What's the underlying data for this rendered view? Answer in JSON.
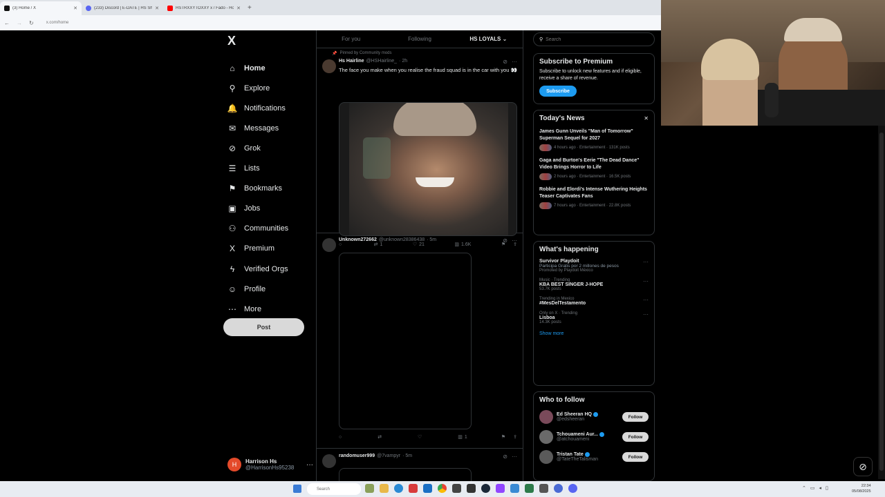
{
  "browser": {
    "tabs": [
      {
        "title": "(3) Home / X",
        "color": "#111111",
        "active": true
      },
      {
        "title": "(233) Discord | E-DATE | HS Sh...",
        "color": "#5865f2",
        "active": false
      },
      {
        "title": "HSTRXXYTOXXY x / Fado - Holic...",
        "color": "#ff0000",
        "active": false
      }
    ],
    "url": "x.com/home",
    "new_tab": "+"
  },
  "nav": {
    "logo": "X",
    "items": [
      {
        "label": "Home",
        "icon": "home-icon",
        "glyph": "⌂"
      },
      {
        "label": "Explore",
        "icon": "search-icon",
        "glyph": "⚲"
      },
      {
        "label": "Notifications",
        "icon": "bell-icon",
        "glyph": "🔔"
      },
      {
        "label": "Messages",
        "icon": "envelope-icon",
        "glyph": "✉"
      },
      {
        "label": "Grok",
        "icon": "grok-icon",
        "glyph": "⊘"
      },
      {
        "label": "Lists",
        "icon": "list-icon",
        "glyph": "☰"
      },
      {
        "label": "Bookmarks",
        "icon": "bookmark-icon",
        "glyph": "⚑"
      },
      {
        "label": "Jobs",
        "icon": "briefcase-icon",
        "glyph": "▣"
      },
      {
        "label": "Communities",
        "icon": "people-icon",
        "glyph": "⚇"
      },
      {
        "label": "Premium",
        "icon": "x-icon",
        "glyph": "X"
      },
      {
        "label": "Verified Orgs",
        "icon": "lightning-icon",
        "glyph": "ϟ"
      },
      {
        "label": "Profile",
        "icon": "person-icon",
        "glyph": "☺"
      },
      {
        "label": "More",
        "icon": "more-circle-icon",
        "glyph": "⋯"
      }
    ],
    "post_label": "Post",
    "account": {
      "initial": "H",
      "name": "Harrison Hs",
      "handle": "@HarrisonHs95238",
      "more": "···"
    }
  },
  "timeline": {
    "tabs": [
      "For you",
      "Following",
      "HS LOYALS ⌄"
    ],
    "tweets": [
      {
        "pinned": "Pinned by Community mods",
        "name": "Hs Hairline",
        "handle": "@HSHairline_",
        "time": "· 2h",
        "text": "The face you make when you realise the fraud squad is in the car with you 👀",
        "replies": "",
        "retweets": "1",
        "likes": "21",
        "views": "1.6K"
      },
      {
        "name": "Unknown272662",
        "handle": "@unknown28386438",
        "time": "· 5m",
        "replies": "",
        "retweets": "",
        "likes": "",
        "views": "1"
      },
      {
        "name": "randomuser999",
        "handle": "@7vampyr",
        "time": "· 5m"
      }
    ]
  },
  "right": {
    "search_placeholder": "Search",
    "premium": {
      "title": "Subscribe to Premium",
      "text": "Subscribe to unlock new features and if eligible, receive a share of revenue.",
      "button": "Subscribe"
    },
    "news": {
      "title": "Today's News",
      "close": "✕",
      "items": [
        {
          "title": "James Gunn Unveils \"Man of Tomorrow\" Superman Sequel for 2027",
          "meta": "4 hours ago · Entertainment · 131K posts"
        },
        {
          "title": "Gaga and Burton's Eerie \"The Dead Dance\" Video Brings Horror to Life",
          "meta": "2 hours ago · Entertainment · 16.5K posts"
        },
        {
          "title": "Robbie and Elordi's Intense Wuthering Heights Teaser Captivates Fans",
          "meta": "7 hours ago · Entertainment · 22.8K posts"
        }
      ]
    },
    "happening": {
      "title": "What's happening",
      "items": [
        {
          "ctx": "",
          "name": "Survivor Playdoit",
          "line2": "Participa Gratis por 2 millones de pesos",
          "count": "Promoted by Playdoit México"
        },
        {
          "ctx": "Music · Trending",
          "name": "KBA BEST SINGER J-HOPE",
          "line2": "",
          "count": "53.7K posts"
        },
        {
          "ctx": "Trending in Mexico",
          "name": "#MesDelTestamento",
          "line2": "",
          "count": ""
        },
        {
          "ctx": "Only on X · Trending",
          "name": "Lisboa",
          "line2": "",
          "count": "14.3K posts"
        }
      ],
      "show_more": "Show more"
    },
    "who": {
      "title": "Who to follow",
      "items": [
        {
          "name": "Ed Sheeran HQ",
          "handle": "@edsheeran",
          "button": "Follow"
        },
        {
          "name": "Tchouameni Aur...",
          "handle": "@atchouameni",
          "button": "Follow"
        },
        {
          "name": "Tristan Tate",
          "handle": "@TateTheTalisman",
          "button": "Follow"
        }
      ]
    }
  },
  "taskbar": {
    "search": "Search",
    "time": "22:34",
    "date": "05/08/2025"
  }
}
